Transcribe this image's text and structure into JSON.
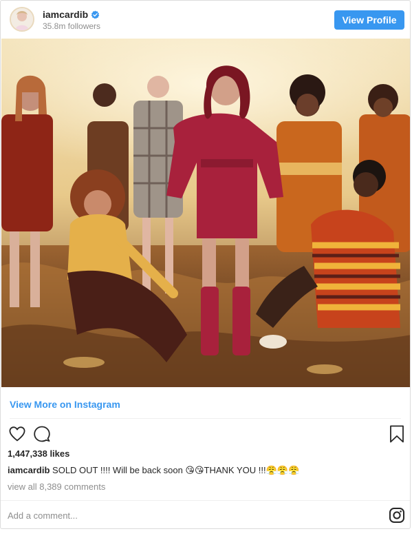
{
  "header": {
    "username": "iamcardib",
    "verified": true,
    "followers": "35.8m followers",
    "view_profile_label": "View Profile"
  },
  "post": {
    "view_more_label": "View More on Instagram",
    "likes": "1,447,338 likes",
    "caption_user": "iamcardib",
    "caption_text": " SOLD OUT !!!! Will be back soon 😘😘THANK YOU !!!😤😤😤",
    "view_comments": "view all 8,389 comments",
    "comment_placeholder": "Add a comment..."
  },
  "icons": {
    "avatar": "profile-avatar",
    "verified": "verified-badge-icon",
    "like": "heart-icon",
    "comment": "comment-icon",
    "save": "bookmark-icon",
    "brand": "instagram-icon"
  },
  "colors": {
    "accent": "#3897f0",
    "text": "#262626",
    "muted": "#8e8e8e",
    "border": "#dbdbdb"
  }
}
